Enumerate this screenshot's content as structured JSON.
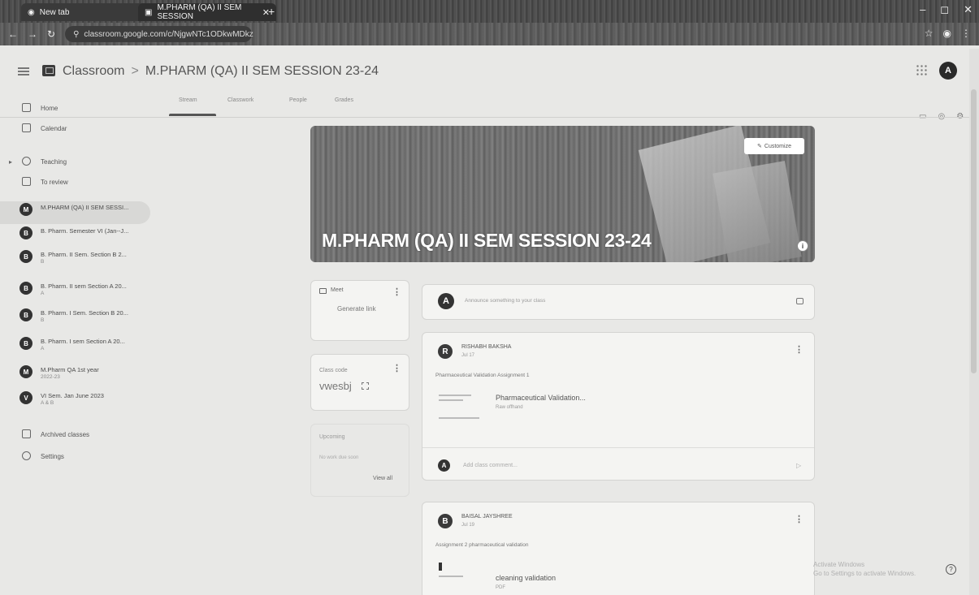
{
  "browser": {
    "tabs": [
      {
        "title": "New tab"
      },
      {
        "title": "M.PHARM (QA) II SEM SESSION"
      }
    ],
    "url": "classroom.google.com/c/NjgwNTc1ODkwMDkz"
  },
  "header": {
    "app_name": "Classroom",
    "separator": ">",
    "class_title": "M.PHARM (QA) II SEM SESSION 23-24",
    "avatar_letter": "A"
  },
  "sidebar": {
    "home": "Home",
    "calendar": "Calendar",
    "teaching": "Teaching",
    "to_review": "To review",
    "classes": [
      {
        "letter": "M",
        "name": "M.PHARM (QA) II SEM SESSI...",
        "sub": ""
      },
      {
        "letter": "B",
        "name": "B. Pharm. Semester VI (Jan--J...",
        "sub": ""
      },
      {
        "letter": "B",
        "name": "B. Pharm. II Sem. Section B 2...",
        "sub": "B"
      },
      {
        "letter": "B",
        "name": "B. Pharm. II sem Section A 20...",
        "sub": "A"
      },
      {
        "letter": "B",
        "name": "B. Pharm. I Sem. Section B 20...",
        "sub": "B"
      },
      {
        "letter": "B",
        "name": "B. Pharm. I sem Section A 20...",
        "sub": "A"
      },
      {
        "letter": "M",
        "name": "M.Pharm QA 1st year",
        "sub": "2022-23"
      },
      {
        "letter": "V",
        "name": "VI Sem. Jan June 2023",
        "sub": "A & B"
      }
    ],
    "archived": "Archived classes",
    "settings": "Settings"
  },
  "tabs": {
    "stream": "Stream",
    "classwork": "Classwork",
    "people": "People",
    "grades": "Grades"
  },
  "banner": {
    "title": "M.PHARM (QA) II SEM SESSION 23-24",
    "customize": "Customize"
  },
  "meet": {
    "label": "Meet",
    "generate": "Generate link"
  },
  "class_code": {
    "label": "Class code",
    "value": "vwesbj"
  },
  "upcoming": {
    "title": "Upcoming",
    "sub": "No work due soon",
    "view_all": "View all"
  },
  "announce": {
    "avatar": "A",
    "placeholder": "Announce something to your class"
  },
  "posts": [
    {
      "avatar": "R",
      "author": "RISHABH BAKSHA",
      "date": "Jul 17",
      "body": "Pharmaceutical Validation Assignment 1",
      "attachment_title": "Pharmaceutical Validation...",
      "attachment_type": "Raw offhand",
      "comment_avatar": "A",
      "comment_placeholder": "Add class comment..."
    },
    {
      "avatar": "B",
      "author": "BAISAL JAYSHREE",
      "date": "Jul 19",
      "body": "Assignment 2 pharmaceutical validation",
      "attachment_title": "cleaning validation",
      "attachment_type": "PDF"
    }
  ],
  "watermark": {
    "line1": "Activate Windows",
    "line2": "Go to Settings to activate Windows."
  },
  "help": "?"
}
